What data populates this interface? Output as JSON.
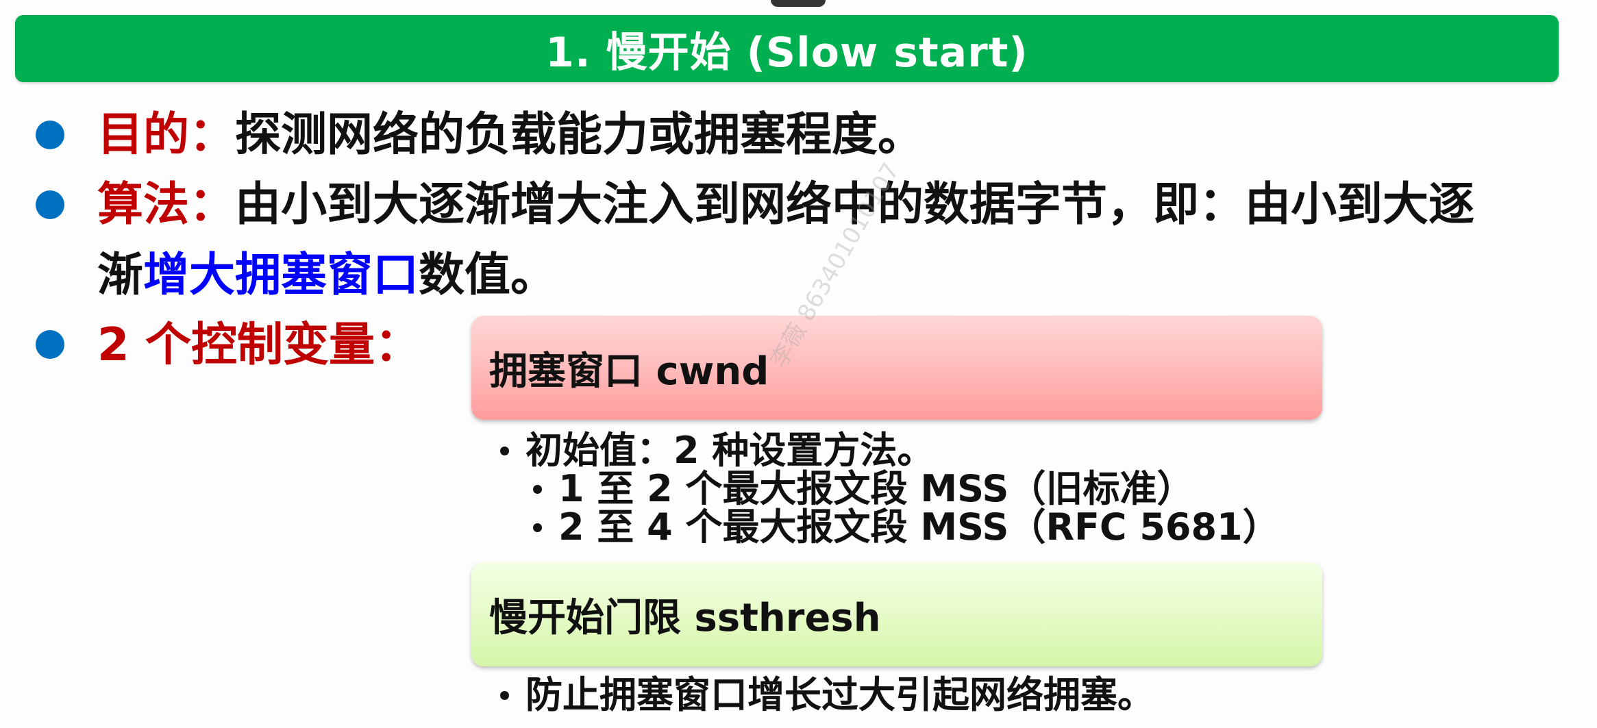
{
  "title": "1. 慢开始 (Slow start)",
  "bullets": [
    {
      "label": "目的：",
      "text": "探测网络的负载能力或拥塞程度。"
    },
    {
      "label": "算法：",
      "text_line1": "由小到大逐渐增大注入到网络中的数据字节，即：由小到大逐",
      "text_line2_pre": "渐",
      "text_line2_highlight": "增大拥塞窗口",
      "text_line2_post": "数值。"
    },
    {
      "label": "2 个控制变量："
    }
  ],
  "variables": [
    {
      "name": "拥塞窗口 cwnd",
      "details": [
        "初始值：2 种设置方法。",
        "1 至 2 个最大报文段 MSS（旧标准）",
        "2 至 4 个最大报文段 MSS（RFC 5681）"
      ]
    },
    {
      "name": "慢开始门限 ssthresh",
      "details": [
        "防止拥塞窗口增长过大引起网络拥塞。"
      ]
    }
  ],
  "watermark": "李薇 863401010107",
  "colors": {
    "title_bar": "#00b050",
    "bullet": "#0070c0",
    "label": "#c00000",
    "highlight": "#0000ff"
  }
}
